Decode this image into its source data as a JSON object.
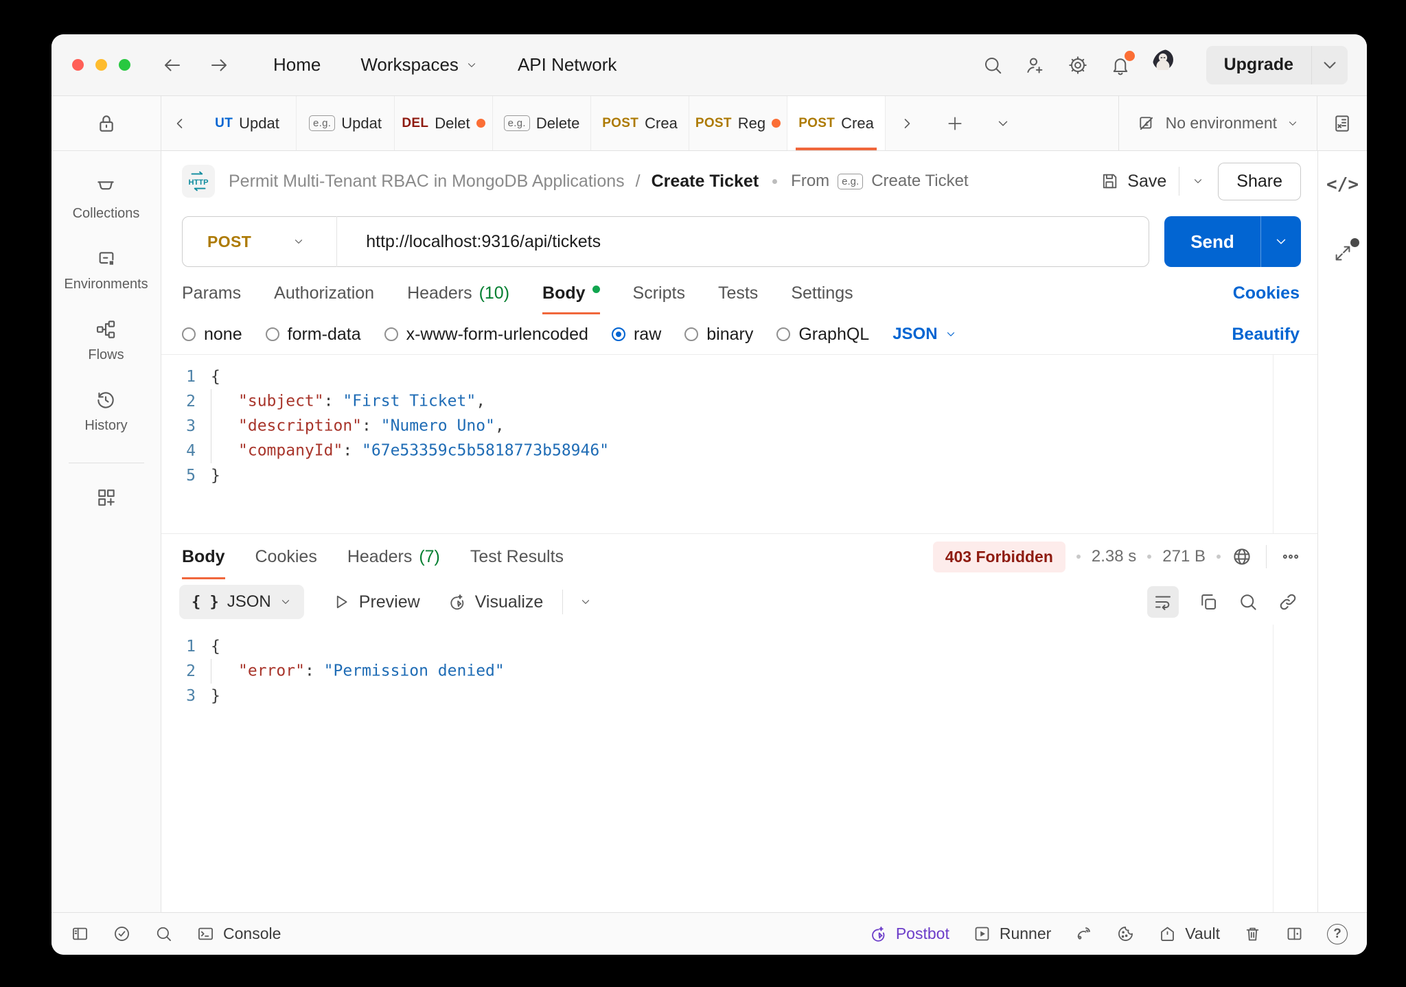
{
  "titlebar": {
    "nav": {
      "home": "Home",
      "workspaces": "Workspaces",
      "api_network": "API Network"
    },
    "upgrade_label": "Upgrade"
  },
  "tabbar": {
    "tabs": [
      {
        "method": "UT",
        "label": "Updat",
        "dirty": false,
        "active": false
      },
      {
        "method": "e.g.",
        "label": "Updat",
        "dirty": false,
        "active": false
      },
      {
        "method": "DEL",
        "label": "Delet",
        "dirty": true,
        "active": false
      },
      {
        "method": "e.g.",
        "label": "Delete",
        "dirty": false,
        "active": false
      },
      {
        "method": "POST",
        "label": "Crea",
        "dirty": false,
        "active": false
      },
      {
        "method": "POST",
        "label": "Reg",
        "dirty": true,
        "active": false
      },
      {
        "method": "POST",
        "label": "Crea",
        "dirty": false,
        "active": true
      }
    ],
    "environment": "No environment"
  },
  "sidebar": {
    "items": [
      {
        "label": "Collections"
      },
      {
        "label": "Environments"
      },
      {
        "label": "Flows"
      },
      {
        "label": "History"
      }
    ]
  },
  "breadcrumb": {
    "http_badge": "HTTP",
    "collection": "Permit Multi-Tenant RBAC in MongoDB Applications",
    "separator": "/",
    "request": "Create Ticket",
    "from_label": "From",
    "eg_badge": "e.g.",
    "from_example": "Create Ticket"
  },
  "actions": {
    "save": "Save",
    "share": "Share",
    "send": "Send"
  },
  "request": {
    "method": "POST",
    "url": "http://localhost:9316/api/tickets",
    "tabs": [
      "Params",
      "Authorization",
      "Headers",
      "Body",
      "Scripts",
      "Tests",
      "Settings"
    ],
    "headers_count": "(10)",
    "cookies_link": "Cookies",
    "body_modes": [
      "none",
      "form-data",
      "x-www-form-urlencoded",
      "raw",
      "binary",
      "GraphQL"
    ],
    "selected_mode": "raw",
    "language": "JSON",
    "beautify_link": "Beautify"
  },
  "request_editor": {
    "lines": [
      {
        "num": "1",
        "indent": false,
        "tokens": [
          {
            "t": "punct",
            "v": "{"
          }
        ]
      },
      {
        "num": "2",
        "indent": true,
        "tokens": [
          {
            "t": "key",
            "v": "\"subject\""
          },
          {
            "t": "punct",
            "v": ": "
          },
          {
            "t": "str",
            "v": "\"First Ticket\""
          },
          {
            "t": "punct",
            "v": ","
          }
        ]
      },
      {
        "num": "3",
        "indent": true,
        "tokens": [
          {
            "t": "key",
            "v": "\"description\""
          },
          {
            "t": "punct",
            "v": ": "
          },
          {
            "t": "str",
            "v": "\"Numero Uno\""
          },
          {
            "t": "punct",
            "v": ","
          }
        ]
      },
      {
        "num": "4",
        "indent": true,
        "tokens": [
          {
            "t": "key",
            "v": "\"companyId\""
          },
          {
            "t": "punct",
            "v": ": "
          },
          {
            "t": "str",
            "v": "\"67e53359c5b5818773b58946\""
          }
        ]
      },
      {
        "num": "5",
        "indent": false,
        "tokens": [
          {
            "t": "punct",
            "v": "}"
          }
        ]
      }
    ]
  },
  "response": {
    "tabs": [
      "Body",
      "Cookies",
      "Headers",
      "Test Results"
    ],
    "headers_count": "(7)",
    "status": "403 Forbidden",
    "time": "2.38 s",
    "size": "271 B",
    "format": "JSON",
    "preview_label": "Preview",
    "visualize_label": "Visualize"
  },
  "response_editor": {
    "lines": [
      {
        "num": "1",
        "indent": false,
        "tokens": [
          {
            "t": "punct",
            "v": "{"
          }
        ]
      },
      {
        "num": "2",
        "indent": true,
        "tokens": [
          {
            "t": "key",
            "v": "\"error\""
          },
          {
            "t": "punct",
            "v": ": "
          },
          {
            "t": "str",
            "v": "\"Permission denied\""
          }
        ]
      },
      {
        "num": "3",
        "indent": false,
        "tokens": [
          {
            "t": "punct",
            "v": "}"
          }
        ]
      }
    ]
  },
  "statusbar": {
    "console": "Console",
    "postbot": "Postbot",
    "runner": "Runner",
    "vault": "Vault"
  },
  "colors": {
    "accent_orange": "#f0673c",
    "blue": "#0265d2",
    "green": "#047f31",
    "post_amber": "#ad7a03",
    "delete_red": "#8e1a10",
    "status_error_text": "#8e1b10",
    "status_error_bg": "#fdeceb",
    "postbot_purple": "#6c3dc9",
    "traffic_red": "#ff5f57",
    "traffic_yellow": "#febc2e",
    "traffic_green": "#28c840"
  }
}
